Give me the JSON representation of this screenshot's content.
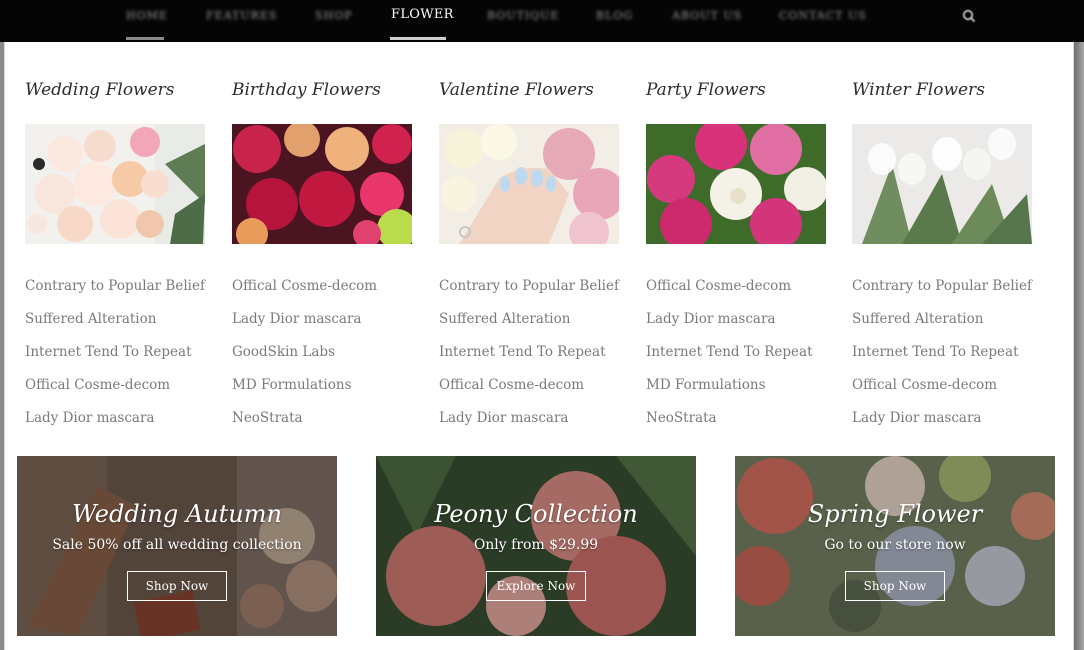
{
  "nav": {
    "items": [
      "HOME",
      "FEATURES",
      "SHOP",
      "FLOWER",
      "BOUTIQUE",
      "BLOG",
      "ABOUT US",
      "CONTACT US"
    ],
    "active_index": 3,
    "search_icon": "search-icon"
  },
  "columns": [
    {
      "title": "Wedding Flowers",
      "image": "wedding-bouquet-image",
      "links": [
        "Contrary to Popular Belief",
        "Suffered Alteration",
        "Internet Tend To Repeat",
        "Offical Cosme-decom",
        "Lady Dior mascara"
      ]
    },
    {
      "title": "Birthday Flowers",
      "image": "birthday-bouquet-image",
      "links": [
        "Offical Cosme-decom",
        "Lady Dior mascara",
        "GoodSkin Labs",
        "MD Formulations",
        "NeoStrata"
      ]
    },
    {
      "title": "Valentine Flowers",
      "image": "valentine-bouquet-image",
      "links": [
        "Contrary to Popular Belief",
        "Suffered Alteration",
        "Internet Tend To Repeat",
        "Offical Cosme-decom",
        "Lady Dior mascara"
      ]
    },
    {
      "title": "Party Flowers",
      "image": "party-bouquet-image",
      "links": [
        "Offical Cosme-decom",
        "Lady Dior mascara",
        "Internet Tend To Repeat",
        "MD Formulations",
        "NeoStrata"
      ]
    },
    {
      "title": "Winter Flowers",
      "image": "winter-bouquet-image",
      "links": [
        "Contrary to Popular Belief",
        "Suffered Alteration",
        "Internet Tend To Repeat",
        "Offical Cosme-decom",
        "Lady Dior mascara"
      ]
    }
  ],
  "banners": [
    {
      "title": "Wedding Autumn",
      "subtitle": "Sale 50% off all wedding collection",
      "button": "Shop Now",
      "image": "wedding-shoes-image"
    },
    {
      "title": "Peony Collection",
      "subtitle": "Only from $29.99",
      "button": "Explore Now",
      "image": "peony-image"
    },
    {
      "title": "Spring Flower",
      "subtitle": "Go to our store now",
      "button": "Shop Now",
      "image": "spring-flower-image"
    }
  ],
  "colors": {
    "nav_bg": "#050505",
    "panel_bg": "#ffffff",
    "title_text": "#2d2d2d",
    "link_text": "#7a7a7a"
  }
}
